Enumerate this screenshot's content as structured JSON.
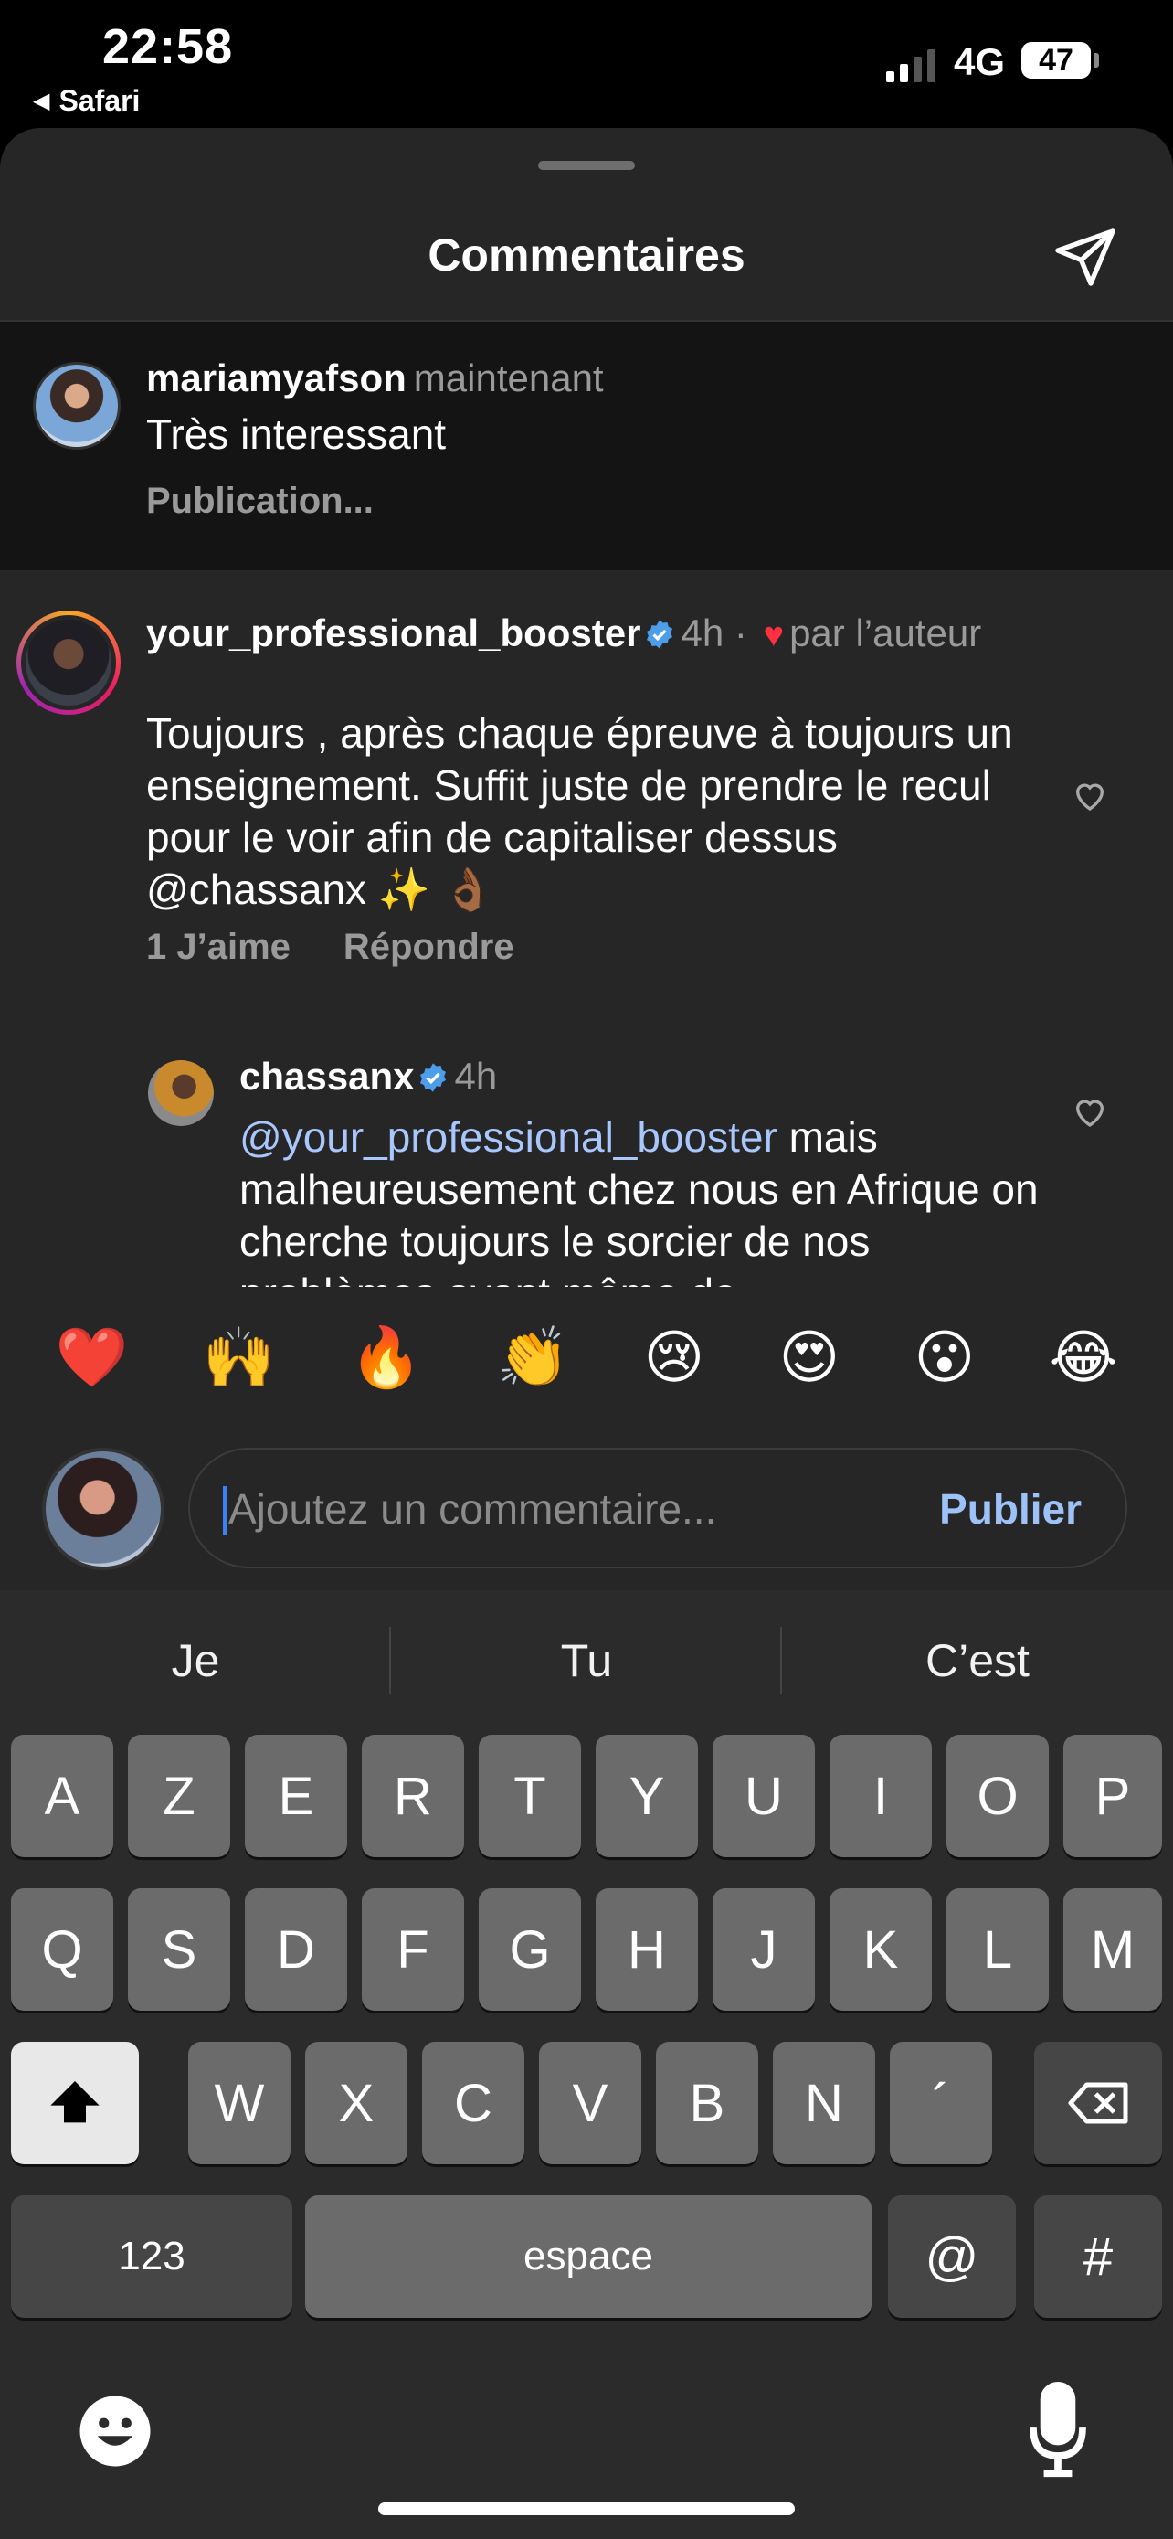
{
  "status_bar": {
    "time": "22:58",
    "back_app": "Safari",
    "network": "4G",
    "battery": "47"
  },
  "sheet": {
    "title": "Commentaires",
    "share_icon": "paper-plane-icon"
  },
  "pending_comment": {
    "username": "mariamyafson",
    "time": "maintenant",
    "text": "Très interessant",
    "status": "Publication..."
  },
  "comments": [
    {
      "username": "your_professional_booster",
      "time": "4h",
      "liked_by_author": "par l’auteur",
      "text": "Toujours , après chaque épreuve à toujours un enseignement. Suffit juste de prendre le recul pour le voir afin de capitaliser dessus @chassanx ✨ 👌🏾",
      "likes_label": "1 J’aime",
      "reply_label": "Répondre",
      "reply": {
        "username": "chassanx",
        "time": "4h",
        "mention": "@your_professional_booster",
        "text": " mais malheureusement chez nous en Afrique on cherche toujours le sorcier de nos problèmes avant même de"
      }
    }
  ],
  "quick_reactions": [
    "❤️",
    "🙌",
    "🔥",
    "👏",
    "😢",
    "😍",
    "😮",
    "😂"
  ],
  "composer": {
    "placeholder": "Ajoutez un commentaire...",
    "publish_label": "Publier"
  },
  "keyboard": {
    "suggestions": [
      "Je",
      "Tu",
      "C’est"
    ],
    "row1": [
      "A",
      "Z",
      "E",
      "R",
      "T",
      "Y",
      "U",
      "I",
      "O",
      "P"
    ],
    "row2": [
      "Q",
      "S",
      "D",
      "F",
      "G",
      "H",
      "J",
      "K",
      "L",
      "M"
    ],
    "row3": [
      "W",
      "X",
      "C",
      "V",
      "B",
      "N",
      "´"
    ],
    "numbers_label": "123",
    "space_label": "espace",
    "at_label": "@",
    "hash_label": "#"
  }
}
